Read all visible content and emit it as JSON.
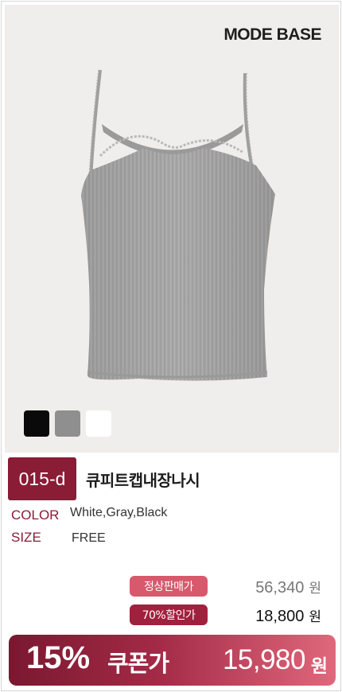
{
  "brand": {
    "name": "MODE BASE"
  },
  "product": {
    "code": "015-d",
    "name": "큐피트캡내장나시",
    "image_icon": "camisole-tank-top",
    "fabric_color": "#a8a8a8",
    "swatches": [
      {
        "name": "black",
        "color": "#0a0a0a"
      },
      {
        "name": "gray",
        "color": "#8f8f8f"
      },
      {
        "name": "white",
        "color": "#ffffff"
      }
    ]
  },
  "specs": {
    "color_label": "COLOR",
    "color_value": "White,Gray,Black",
    "size_label": "SIZE",
    "size_value": "FREE"
  },
  "pricing": {
    "regular_label": "정상판매가",
    "regular_price": "56,340",
    "discount_label": "70%할인가",
    "discount_price": "18,800",
    "currency": "원"
  },
  "coupon": {
    "percent": "15%",
    "label": "쿠폰가",
    "price": "15,980",
    "currency": "원"
  },
  "colors": {
    "accent": "#8a1c36",
    "tag_pink": "#d8586c",
    "tag_wine": "#a0213d"
  }
}
